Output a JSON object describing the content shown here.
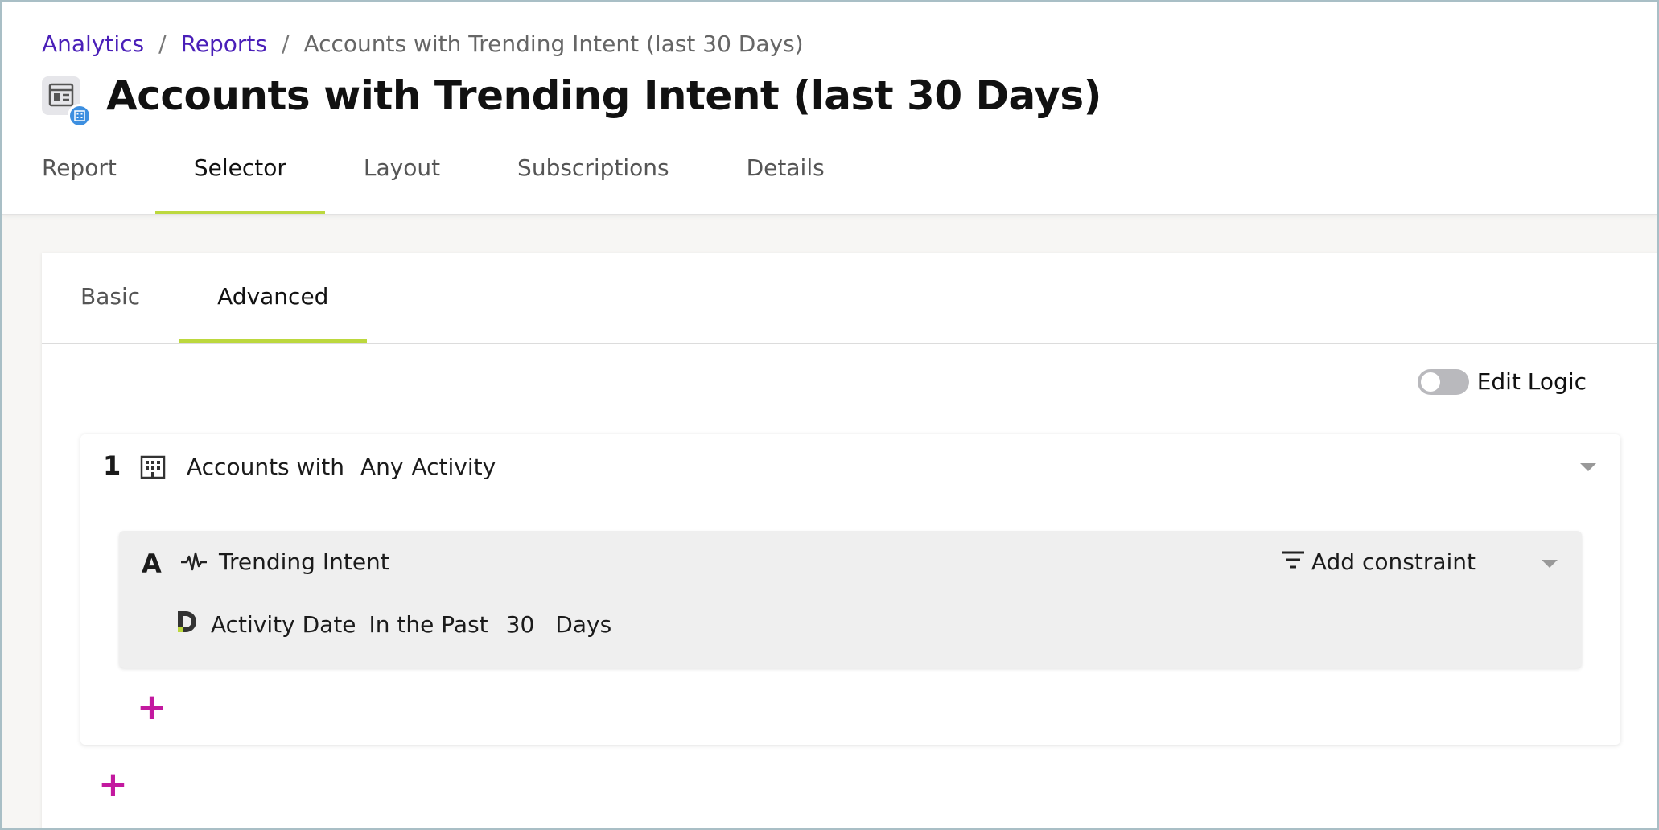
{
  "breadcrumb": {
    "items": [
      "Analytics",
      "Reports"
    ],
    "separator": "/",
    "current": "Accounts with Trending Intent (last 30 Days)"
  },
  "page": {
    "title": "Accounts with Trending Intent (last 30 Days)",
    "icon": "report-icon"
  },
  "tabs": [
    "Report",
    "Selector",
    "Layout",
    "Subscriptions",
    "Details"
  ],
  "active_tab": "Selector",
  "subtabs": [
    "Basic",
    "Advanced"
  ],
  "active_subtab": "Advanced",
  "edit_logic": {
    "label": "Edit Logic",
    "enabled": false
  },
  "group": {
    "number": "1",
    "prefix": "Accounts with",
    "quantifier": "Any",
    "type": "Activity",
    "condition": {
      "letter": "A",
      "title": "Trending Intent",
      "add_constraint_label": "Add constraint",
      "constraint": {
        "field": "Activity Date",
        "operator": "In the Past",
        "value": "30",
        "unit": "Days"
      }
    }
  },
  "add_symbol": "+",
  "colors": {
    "link": "#4a1fb8",
    "active_tab_underline": "#bcd83e",
    "add_button": "#c3199f",
    "badge": "#3d8fe0"
  }
}
